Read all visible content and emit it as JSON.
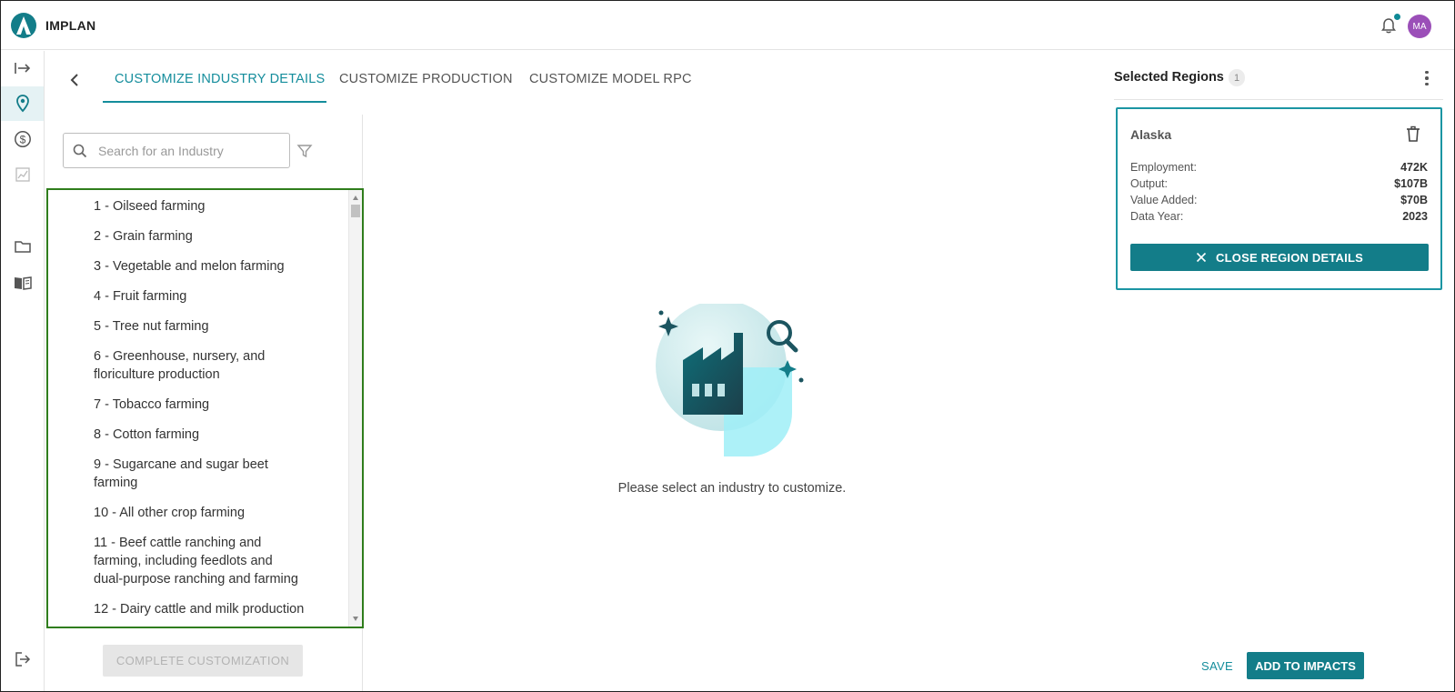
{
  "app": {
    "title": "IMPLAN",
    "avatar_initials": "MA"
  },
  "rail": {
    "items": [
      {
        "icon": "expand-arrow-icon"
      },
      {
        "icon": "location-pin-icon",
        "active": true
      },
      {
        "icon": "dollar-circle-icon"
      },
      {
        "icon": "chart-icon"
      },
      {
        "icon": "folder-icon"
      },
      {
        "icon": "book-icon"
      },
      {
        "icon": "logout-icon"
      }
    ]
  },
  "tabs": [
    {
      "label": "CUSTOMIZE INDUSTRY DETAILS",
      "active": true
    },
    {
      "label": "CUSTOMIZE PRODUCTION"
    },
    {
      "label": "CUSTOMIZE MODEL RPC"
    }
  ],
  "search": {
    "placeholder": "Search for an Industry",
    "value": ""
  },
  "industries": [
    [
      "1 - Oilseed farming"
    ],
    [
      "2 - Grain farming"
    ],
    [
      "3 - Vegetable and melon farming"
    ],
    [
      "4 - Fruit farming"
    ],
    [
      "5 - Tree nut farming"
    ],
    [
      "6 - Greenhouse, nursery, and",
      "floriculture production"
    ],
    [
      "7 - Tobacco farming"
    ],
    [
      "8 - Cotton farming"
    ],
    [
      "9 - Sugarcane and sugar beet",
      "farming"
    ],
    [
      "10 - All other crop farming"
    ],
    [
      "11 - Beef cattle ranching and",
      "farming, including feedlots and",
      "dual-purpose ranching and farming"
    ],
    [
      "12 - Dairy cattle and milk production"
    ]
  ],
  "complete_button": "COMPLETE CUSTOMIZATION",
  "empty_state": {
    "message": "Please select an industry to customize."
  },
  "regions": {
    "title": "Selected Regions",
    "count": "1",
    "selected": {
      "name": "Alaska",
      "stats": [
        {
          "label": "Employment:",
          "value": "472K"
        },
        {
          "label": "Output:",
          "value": "$107B"
        },
        {
          "label": "Value Added:",
          "value": "$70B"
        },
        {
          "label": "Data Year:",
          "value": "2023"
        }
      ],
      "close_label": "CLOSE REGION DETAILS"
    }
  },
  "footer": {
    "save_label": "SAVE",
    "add_label": "ADD TO IMPACTS"
  },
  "colors": {
    "accent": "#137d89",
    "link": "#148d9c",
    "avatar": "#9b4fb8",
    "list_border": "#2f7d1c"
  }
}
